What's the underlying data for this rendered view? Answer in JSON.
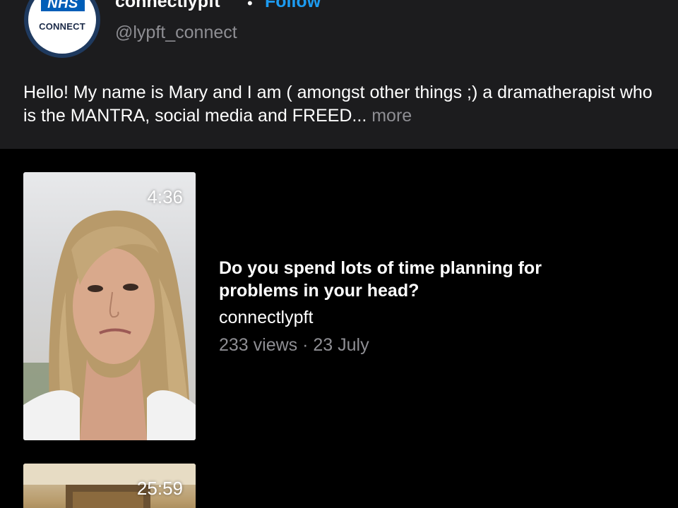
{
  "profile": {
    "avatar_logo_text": "NHS",
    "avatar_logo_sub": "CONNECT",
    "username": "connectlypft",
    "separator": "•",
    "follow_label": "Follow",
    "handle": "@lypft_connect",
    "bio": "Hello! My name is Mary and I am ( amongst other things ;) a dramatherapist who is the MANTRA, social media and FREED... ",
    "bio_more": "more"
  },
  "videos": [
    {
      "duration": "4:36",
      "title": "Do you spend lots of time planning for problems in your head?",
      "author": "connectlypft",
      "meta": "233 views · 23 July"
    },
    {
      "duration": "25:59"
    }
  ],
  "colors": {
    "background": "#000000",
    "header_background": "#1c1c1e",
    "follow_accent": "#1d9bf0",
    "muted_text": "#8e8e93",
    "nhs_blue": "#005eb8"
  }
}
